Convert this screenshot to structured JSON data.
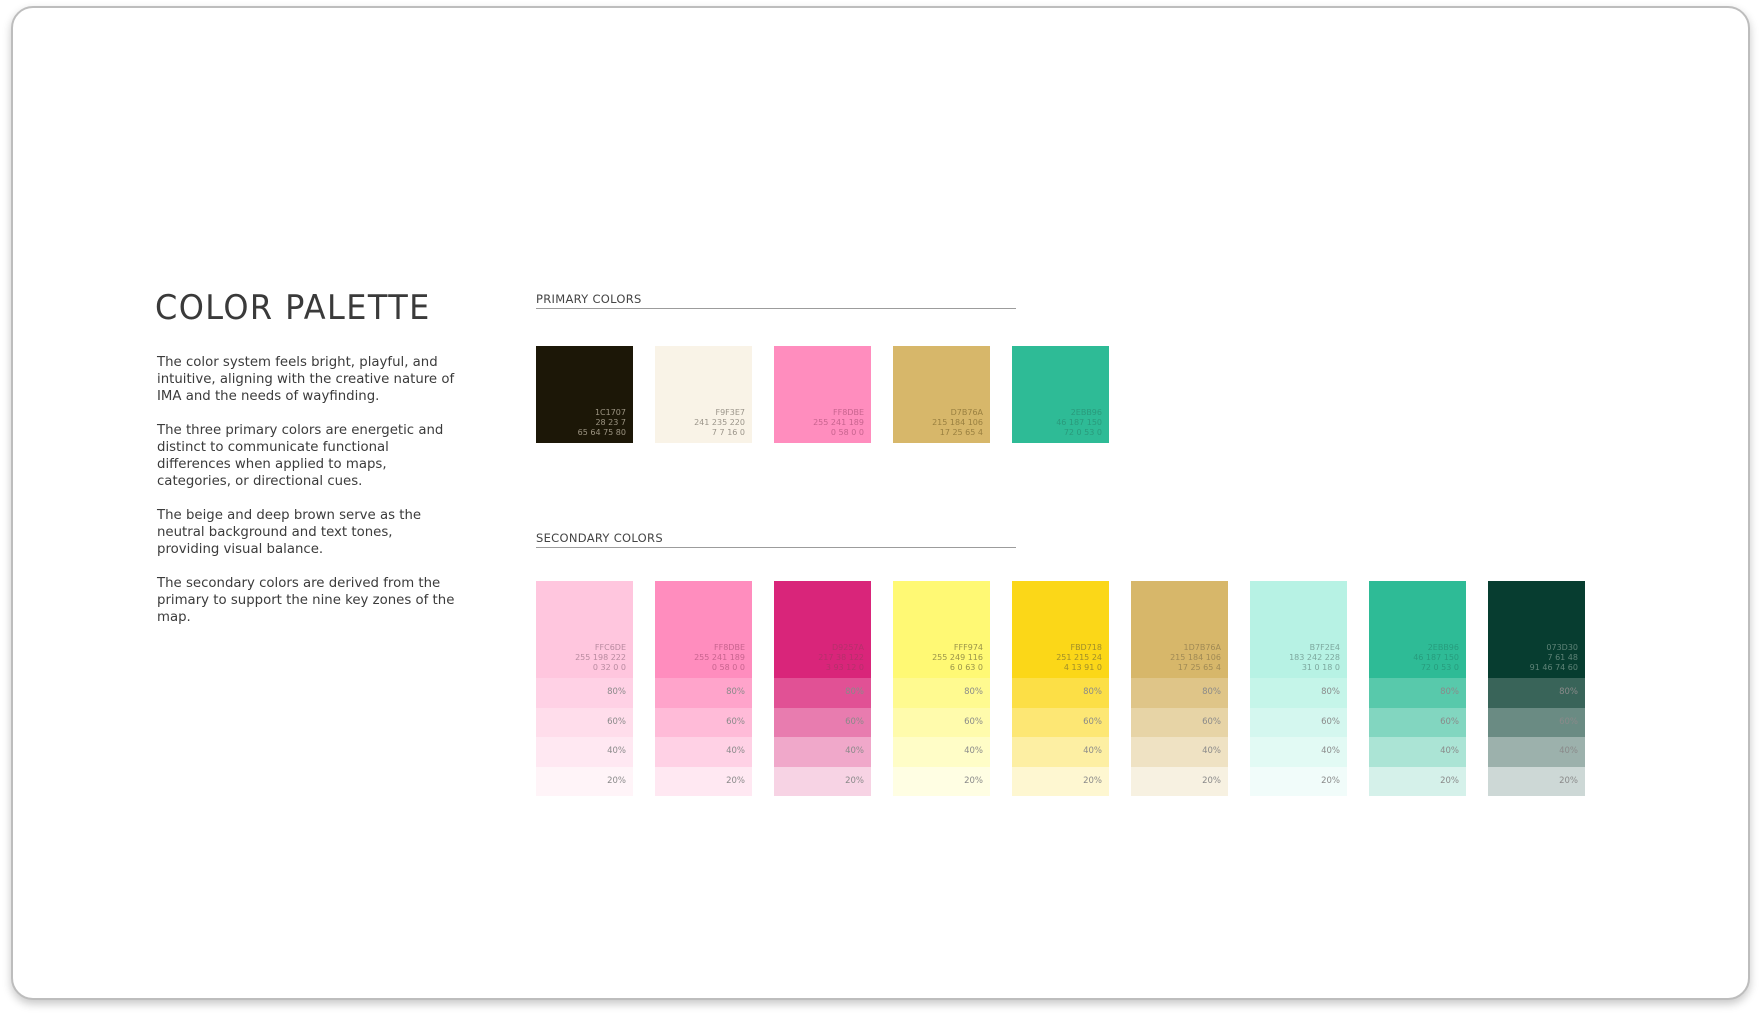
{
  "title": "COLOR PALETTE",
  "description": [
    "The color system feels bright, playful, and intuitive, aligning with the creative nature of IMA and the needs of wayfinding.",
    "The three primary colors are energetic and distinct to communicate functional differences when applied to maps, categories, or directional cues.",
    "The beige and deep brown serve as the neutral background and text tones, providing visual balance.",
    "The secondary colors are derived from the primary to support the nine key zones of the map."
  ],
  "primary": {
    "label": "PRIMARY COLORS",
    "swatches": [
      {
        "color": "#1C1707",
        "text_color": "#9c9482",
        "hex": "1C1707",
        "rgb": "28 23 7",
        "cmyk": "65 64 75 80"
      },
      {
        "color": "#F9F3E7",
        "text_color": "#9b958a",
        "hex": "F9F3E7",
        "rgb": "241 235 220",
        "cmyk": "7 7 16 0"
      },
      {
        "color": "#FF8DBE",
        "text_color": "#c8648f",
        "hex": "FF8DBE",
        "rgb": "255 241 189",
        "cmyk": "0 58 0 0"
      },
      {
        "color": "#D7B76A",
        "text_color": "#9a8040",
        "hex": "D7B76A",
        "rgb": "215 184 106",
        "cmyk": "17 25 65 4"
      },
      {
        "color": "#2EBB96",
        "text_color": "#2a9a7c",
        "hex": "2EBB96",
        "rgb": "46 187 150",
        "cmyk": "72 0 53 0"
      }
    ]
  },
  "secondary": {
    "label": "SECONDARY COLORS",
    "tint_labels": [
      "80%",
      "60%",
      "40%",
      "20%"
    ],
    "swatches": [
      {
        "color": "#FFC6DE",
        "text_color": "#b88ba0",
        "hex": "FFC6DE",
        "rgb": "255 198 222",
        "cmyk": "0 32 0 0"
      },
      {
        "color": "#FF8DBE",
        "text_color": "#c8648f",
        "hex": "FF8DBE",
        "rgb": "255 241 189",
        "cmyk": "0 58 0 0"
      },
      {
        "color": "#D9257A",
        "text_color": "#b5306b",
        "hex": "D9257A",
        "rgb": "217 38 122",
        "cmyk": "3 93 12 0"
      },
      {
        "color": "#FFF974",
        "text_color": "#9a944a",
        "hex": "FFF974",
        "rgb": "255 249 116",
        "cmyk": "6 0 63 0"
      },
      {
        "color": "#FBD718",
        "text_color": "#a08e2a",
        "hex": "FBD718",
        "rgb": "251 215 24",
        "cmyk": "4 13 91 0"
      },
      {
        "color": "#D7B76A",
        "text_color": "#a08a55",
        "hex": "1D7B76A",
        "rgb": "215 184 106",
        "cmyk": "17 25 65 4"
      },
      {
        "color": "#B7F2E4",
        "text_color": "#7da89e",
        "hex": "B7F2E4",
        "rgb": "183 242 228",
        "cmyk": "31 0 18 0"
      },
      {
        "color": "#2EBB96",
        "text_color": "#279c7d",
        "hex": "2EBB96",
        "rgb": "46 187 150",
        "cmyk": "72 0 53 0"
      },
      {
        "color": "#073D30",
        "text_color": "#5e8377",
        "hex": "073D30",
        "rgb": "7 61 48",
        "cmyk": "91 46 74 60"
      }
    ]
  }
}
